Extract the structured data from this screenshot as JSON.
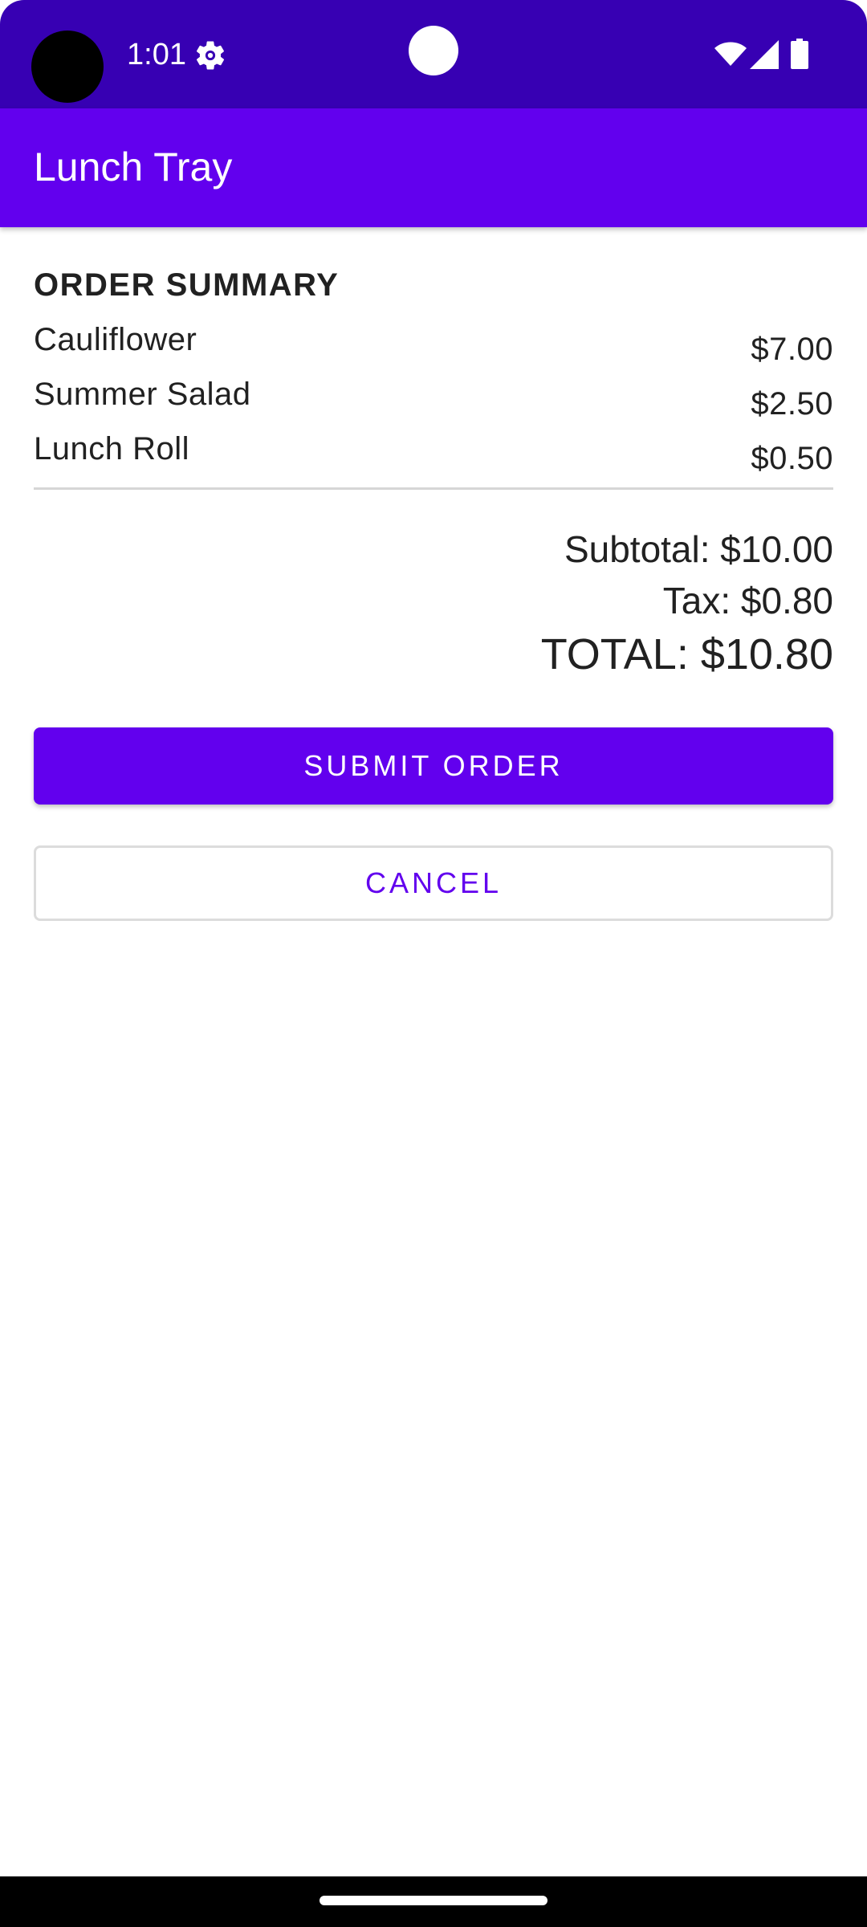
{
  "status_bar": {
    "time": "1:01",
    "icons": [
      "settings-icon",
      "wifi-icon",
      "signal-icon",
      "battery-icon"
    ]
  },
  "app_bar": {
    "title": "Lunch Tray"
  },
  "order_summary": {
    "title": "ORDER SUMMARY",
    "items": [
      {
        "name": "Cauliflower",
        "price": "$7.00"
      },
      {
        "name": "Summer Salad",
        "price": "$2.50"
      },
      {
        "name": "Lunch Roll",
        "price": "$0.50"
      }
    ],
    "subtotal": "Subtotal: $10.00",
    "tax": "Tax: $0.80",
    "total": "TOTAL: $10.80"
  },
  "actions": {
    "submit_label": "SUBMIT ORDER",
    "cancel_label": "CANCEL"
  },
  "colors": {
    "status_bar": "#3700b3",
    "primary": "#6200ee",
    "text": "#212121",
    "divider": "#d6d6d6"
  }
}
